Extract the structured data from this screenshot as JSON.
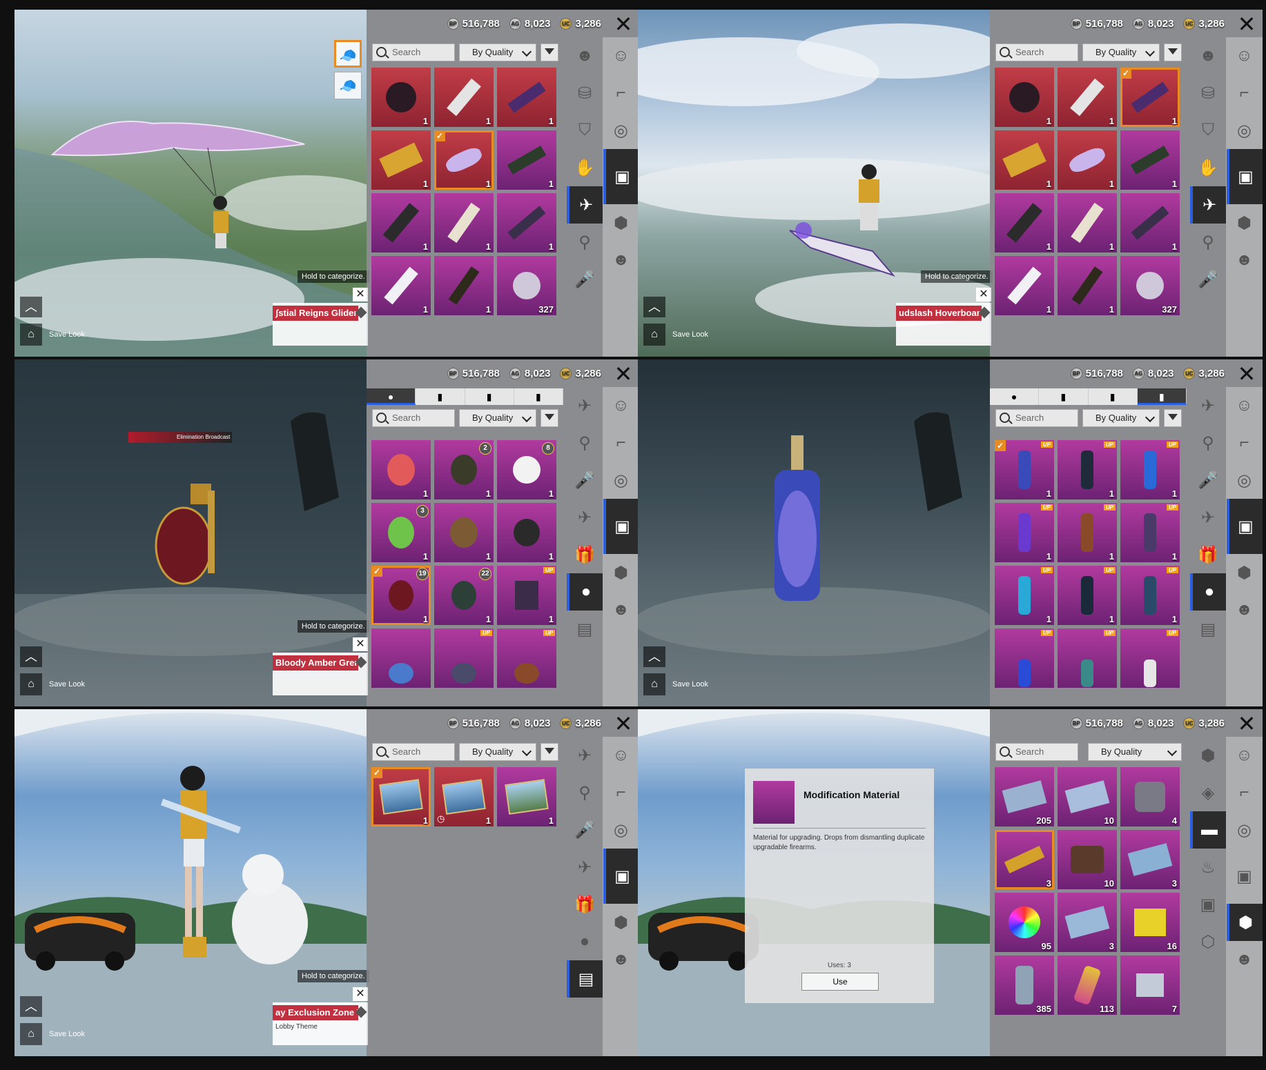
{
  "currency": {
    "bp": "516,788",
    "ag": "8,023",
    "uc": "3,286"
  },
  "common": {
    "search_placeholder": "Search",
    "sort_label": "By Quality",
    "hold_hint": "Hold to categorize.",
    "save_look": "Save Look"
  },
  "panels": {
    "p1": {
      "item_name": "ʃstial Reigns Glider",
      "counts": [
        "1",
        "1",
        "1",
        "1",
        "1",
        "1",
        "1",
        "1",
        "1",
        "1",
        "1",
        "327"
      ]
    },
    "p2": {
      "item_name": "udslash Hoverboar",
      "counts": [
        "1",
        "1",
        "1",
        "1",
        "1",
        "1",
        "1",
        "1",
        "1",
        "1",
        "1",
        "327"
      ]
    },
    "p3": {
      "item_name": "Bloody Amber Grer",
      "broadcast": "Elimination Broadcast",
      "counts": [
        "1",
        "1",
        "1",
        "1",
        "1",
        "1",
        "1",
        "1",
        "1"
      ],
      "levels": [
        "2",
        "8",
        "3",
        "19",
        "22"
      ]
    },
    "p4": {
      "counts": [
        "1",
        "1",
        "1",
        "1",
        "1",
        "1",
        "1",
        "1",
        "1"
      ]
    },
    "p5": {
      "item_name": "ay Exclusion Zone T",
      "sub": "Lobby Theme",
      "counts": [
        "1",
        "1",
        "1"
      ]
    },
    "p6": {
      "detail_title": "Modification Material",
      "detail_desc": "Material for upgrading. Drops from dismantling duplicate upgradable firearms.",
      "uses": "Uses: 3",
      "use_btn": "Use",
      "counts": [
        "205",
        "10",
        "4",
        "3",
        "10",
        "3",
        "95",
        "3",
        "16",
        "385",
        "113",
        "7"
      ]
    }
  },
  "colors": {
    "red_cell": "#c13d47",
    "purple_cell": "#b13a9f",
    "select": "#e88b23",
    "active_tab": "#2c5fe0"
  }
}
